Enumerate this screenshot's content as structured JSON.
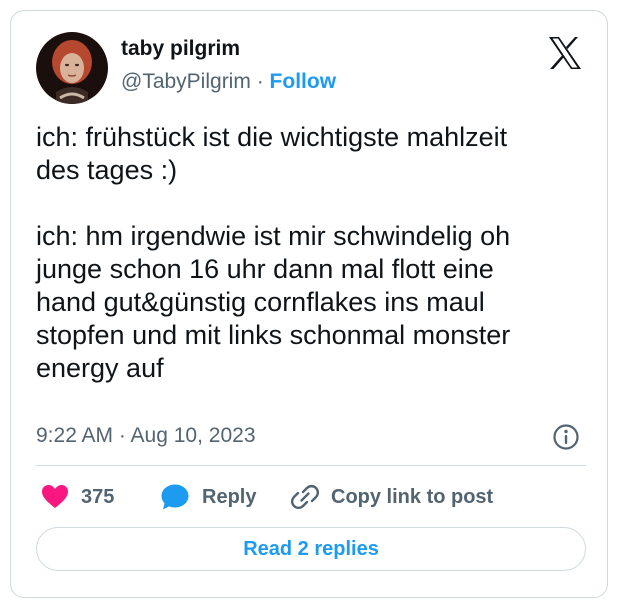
{
  "author": {
    "display_name": "taby pilgrim",
    "handle": "@TabyPilgrim",
    "separator": "·",
    "follow_label": "Follow"
  },
  "tweet": {
    "text": "ich: frühstück ist die wichtigste mahlzeit\ndes tages :)\n\nich: hm irgendwie ist mir schwindelig oh\njunge schon 16 uhr dann mal flott eine\nhand gut&günstig cornflakes ins maul\nstopfen und mit links schonmal monster\nenergy auf",
    "timestamp": "9:22 AM · Aug 10, 2023"
  },
  "actions": {
    "like_count": "375",
    "reply_label": "Reply",
    "copy_label": "Copy link to post"
  },
  "footer": {
    "read_replies_label": "Read 2 replies"
  },
  "colors": {
    "accent": "#1d9bf0",
    "like": "#f91880",
    "text_primary": "#0f1419",
    "text_secondary": "#536471",
    "border": "#cfd9de"
  },
  "icons": {
    "platform": "x-logo-icon",
    "info": "info-icon",
    "like": "heart-icon",
    "reply": "speech-bubble-icon",
    "copy": "link-icon"
  }
}
